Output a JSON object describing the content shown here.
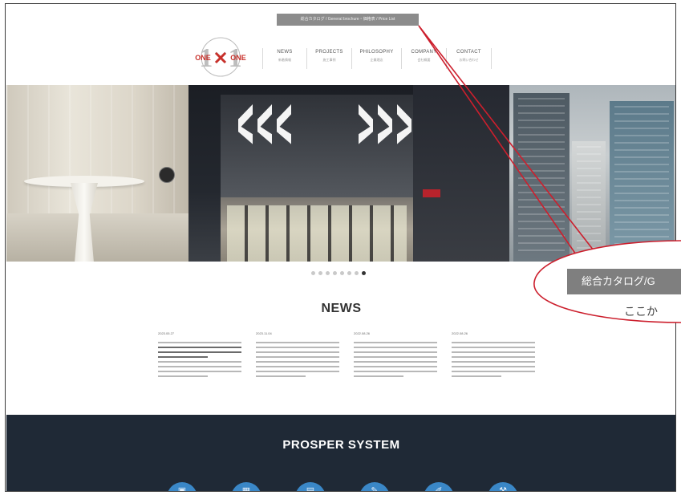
{
  "top_banner": {
    "text": "総合カタログ / General brochure・価格表 / Price List"
  },
  "logo": {
    "text_left": "ONE",
    "text_right": "ONE",
    "mark": "1×1"
  },
  "nav": {
    "items": [
      {
        "en": "NEWS",
        "jp": "新着情報"
      },
      {
        "en": "PROJECTS",
        "jp": "施工事例"
      },
      {
        "en": "PHILOSOPHY",
        "jp": "企業理念"
      },
      {
        "en": "COMPANY",
        "jp": "会社概要"
      },
      {
        "en": "CONTACT",
        "jp": "お問い合わせ"
      }
    ]
  },
  "slider": {
    "count": 8,
    "active_index": 7
  },
  "news": {
    "title": "NEWS",
    "columns": [
      {
        "date": "2023.05.27"
      },
      {
        "date": "2023.11.04"
      },
      {
        "date": "2022.08.26"
      },
      {
        "date": "2022.08.26"
      }
    ]
  },
  "prosper": {
    "title": "PROSPER SYSTEM",
    "icons": [
      "icon-1",
      "icon-2",
      "icon-3",
      "icon-4",
      "icon-5",
      "icon-6"
    ]
  },
  "callout": {
    "label": "総合カタログ/G",
    "sub_text": "ここか",
    "color": "#cc1f2d"
  }
}
